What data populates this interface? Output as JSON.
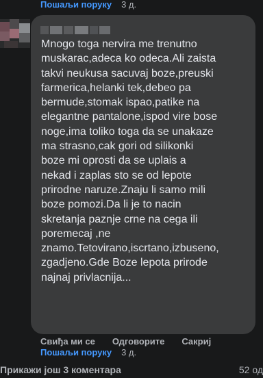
{
  "top": {
    "send_message": "Пошаљи поруку",
    "time": "3 д."
  },
  "comment": {
    "text": "Mnogo toga nervira me trenutno\nmuskarac,adeca ko odeca.Ali zaista\ntakvi neukusa sacuvaj boze,preuski\nfarmerica,helanki tek,debeo pa\nbermude,stomak ispao,patike na\nelegantne pantalone,ispod vire bose\nnoge,ima toliko toga da se unakaze\nma strasno,cak gori od silikonki\nboze mi oprosti da se uplais a\nnekad i zaplas sto se od lepote\nprirodne naruze.Znaju li samo mili\nboze pomozi.Da li je to nacin\nskretanja paznje crne na cega ili\nporemecaj ,ne\nznamo.Tetovirano,iscrtano,izbuseno,\nzgadjeno.Gde Boze lepota prirode\nnajnaj privlacnija..."
  },
  "actions": {
    "like": "Свиђа ми се",
    "reply": "Одговорите",
    "hide": "Сакриј"
  },
  "actions2": {
    "send_message": "Пошаљи поруку",
    "time": "3 д."
  },
  "more": {
    "label": "Прикажи још 3 коментара",
    "count": "52 од"
  }
}
